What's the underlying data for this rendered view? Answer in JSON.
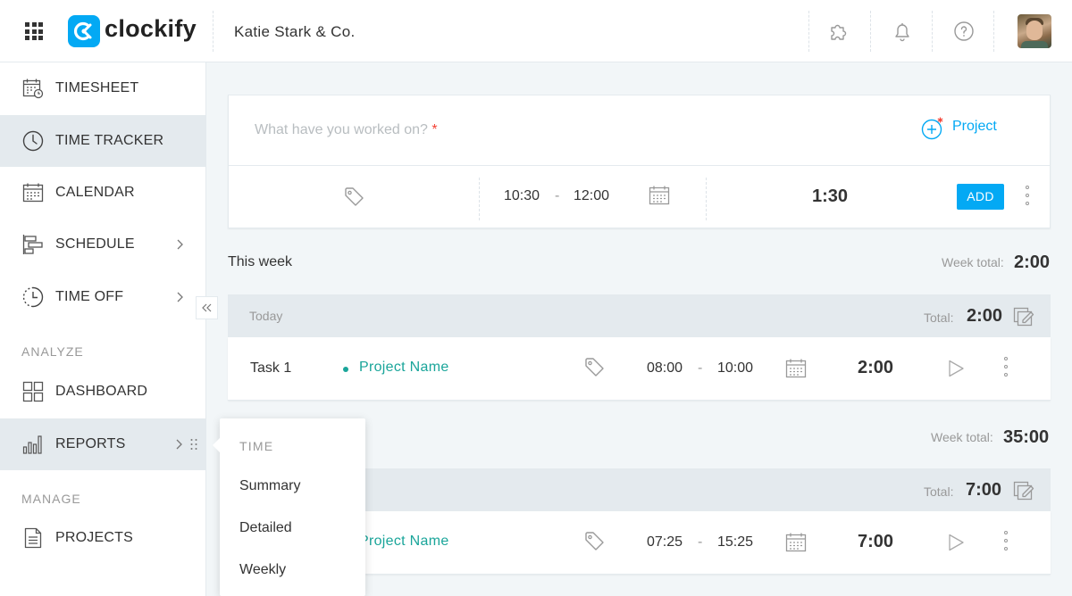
{
  "app": {
    "brand": "clockify",
    "workspace": "Katie Stark & Co."
  },
  "colors": {
    "accent": "#03a9f4",
    "project": "#1aa59a",
    "required": "#f44336"
  },
  "topbar": {
    "icons": [
      "apps-grid-icon",
      "puzzle-icon",
      "bell-icon",
      "help-icon"
    ]
  },
  "sidebar": {
    "items": [
      {
        "label": "TIMESHEET",
        "icon": "timesheet-icon"
      },
      {
        "label": "TIME TRACKER",
        "icon": "clock-icon",
        "active": true
      },
      {
        "label": "CALENDAR",
        "icon": "calendar-icon"
      },
      {
        "label": "SCHEDULE",
        "icon": "schedule-icon",
        "chevron": true
      },
      {
        "label": "TIME OFF",
        "icon": "time-off-icon",
        "chevron": true
      }
    ],
    "analyze_label": "ANALYZE",
    "analyze_items": [
      {
        "label": "DASHBOARD",
        "icon": "dashboard-icon"
      },
      {
        "label": "REPORTS",
        "icon": "reports-icon",
        "chevron": true,
        "active": true
      }
    ],
    "manage_label": "MANAGE",
    "manage_items": [
      {
        "label": "PROJECTS",
        "icon": "projects-icon"
      }
    ]
  },
  "tracker": {
    "placeholder": "What have you worked on?",
    "required_mark": "*",
    "project_label": "Project",
    "start": "10:30",
    "dash": "-",
    "end": "12:00",
    "duration": "1:30",
    "add_label": "ADD"
  },
  "weeks": [
    {
      "title": "This week",
      "total_label": "Week total:",
      "total": "2:00",
      "days": [
        {
          "label": "Today",
          "total_label": "Total:",
          "total": "2:00",
          "entries": [
            {
              "description": "Task 1",
              "project": "Project Name",
              "start": "08:00",
              "end": "10:00",
              "duration": "2:00"
            }
          ]
        }
      ]
    },
    {
      "title": "",
      "total_label": "Week total:",
      "total": "35:00",
      "days": [
        {
          "label": "",
          "total_label": "Total:",
          "total": "7:00",
          "entries": [
            {
              "description": "",
              "project": "Project Name",
              "start": "07:25",
              "end": "15:25",
              "duration": "7:00"
            }
          ]
        }
      ]
    }
  ],
  "reports_menu": {
    "section": "TIME",
    "items": [
      "Summary",
      "Detailed",
      "Weekly"
    ]
  }
}
